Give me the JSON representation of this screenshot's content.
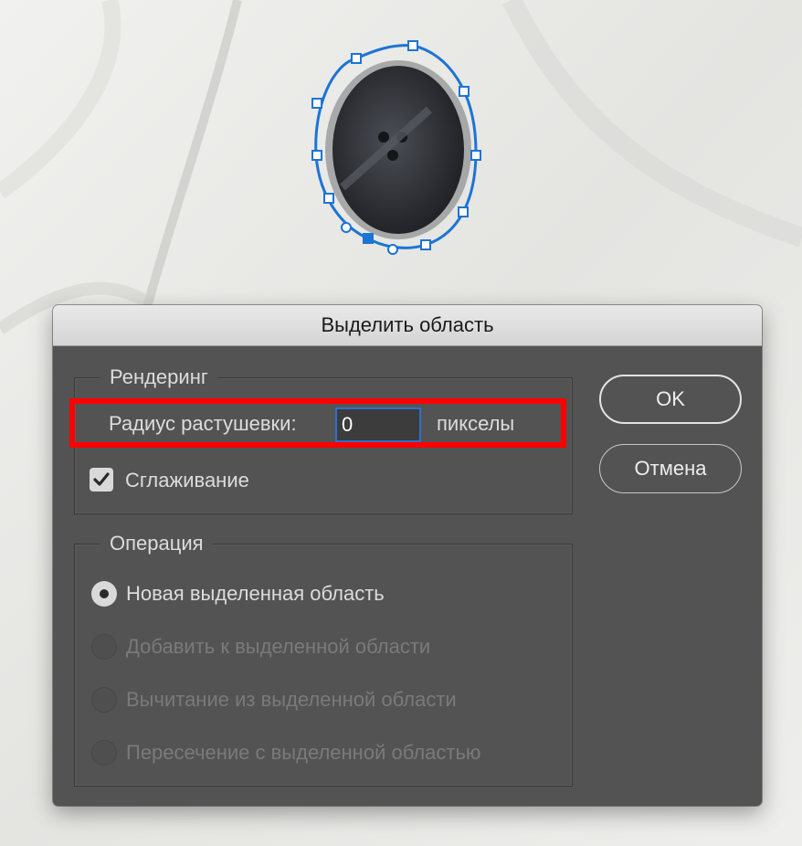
{
  "dialog": {
    "title": "Выделить область",
    "rendering": {
      "legend": "Рендеринг",
      "feather_label": "Радиус растушевки:",
      "feather_value": "0",
      "feather_units": "пикселы",
      "antialias_label": "Сглаживание",
      "antialias_checked": true
    },
    "operation": {
      "legend": "Операция",
      "options": [
        {
          "label": "Новая выделенная область",
          "selected": true,
          "enabled": true
        },
        {
          "label": "Добавить к выделенной области",
          "selected": false,
          "enabled": false
        },
        {
          "label": "Вычитание из выделенной области",
          "selected": false,
          "enabled": false
        },
        {
          "label": "Пересечение с выделенной областью",
          "selected": false,
          "enabled": false
        }
      ]
    },
    "buttons": {
      "ok": "OK",
      "cancel": "Отмена"
    }
  },
  "colors": {
    "dialog_bg": "#535353",
    "highlight": "#ff0000",
    "selection_path": "#1c74d4"
  }
}
